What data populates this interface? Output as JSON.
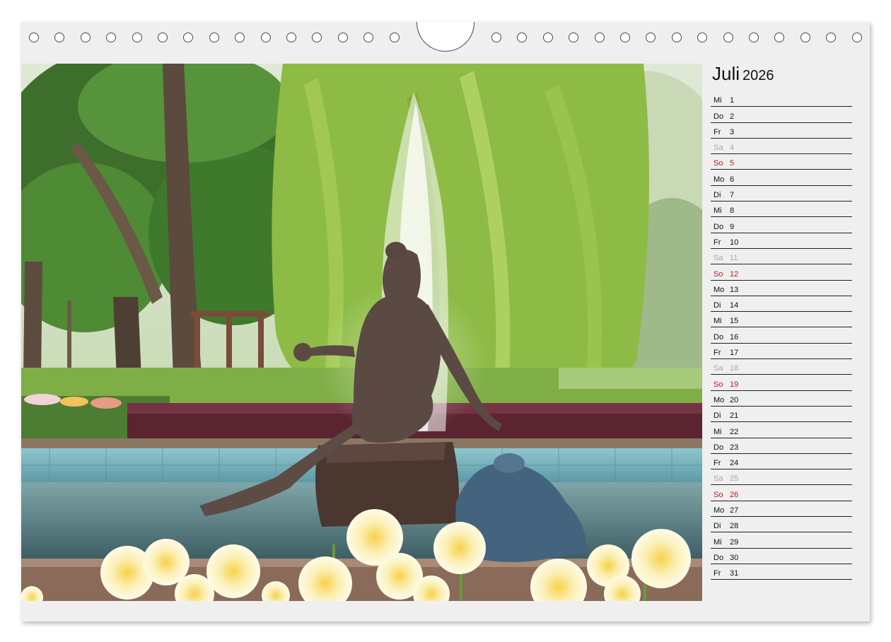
{
  "calendar": {
    "month": "Juli",
    "year": "2026",
    "colors": {
      "weekday": "#111111",
      "saturday": "#a8a8a8",
      "sunday": "#c8161d",
      "page": "#efefef"
    },
    "days": [
      {
        "day": "Mi",
        "date": "1",
        "kind": "weekday"
      },
      {
        "day": "Do",
        "date": "2",
        "kind": "weekday"
      },
      {
        "day": "Fr",
        "date": "3",
        "kind": "weekday"
      },
      {
        "day": "Sa",
        "date": "4",
        "kind": "saturday"
      },
      {
        "day": "So",
        "date": "5",
        "kind": "sunday"
      },
      {
        "day": "Mo",
        "date": "6",
        "kind": "weekday"
      },
      {
        "day": "Di",
        "date": "7",
        "kind": "weekday"
      },
      {
        "day": "Mi",
        "date": "8",
        "kind": "weekday"
      },
      {
        "day": "Do",
        "date": "9",
        "kind": "weekday"
      },
      {
        "day": "Fr",
        "date": "10",
        "kind": "weekday"
      },
      {
        "day": "Sa",
        "date": "11",
        "kind": "saturday"
      },
      {
        "day": "So",
        "date": "12",
        "kind": "sunday"
      },
      {
        "day": "Mo",
        "date": "13",
        "kind": "weekday"
      },
      {
        "day": "Di",
        "date": "14",
        "kind": "weekday"
      },
      {
        "day": "Mi",
        "date": "15",
        "kind": "weekday"
      },
      {
        "day": "Do",
        "date": "16",
        "kind": "weekday"
      },
      {
        "day": "Fr",
        "date": "17",
        "kind": "weekday"
      },
      {
        "day": "Sa",
        "date": "18",
        "kind": "saturday"
      },
      {
        "day": "So",
        "date": "19",
        "kind": "sunday"
      },
      {
        "day": "Mo",
        "date": "20",
        "kind": "weekday"
      },
      {
        "day": "Di",
        "date": "21",
        "kind": "weekday"
      },
      {
        "day": "Mi",
        "date": "22",
        "kind": "weekday"
      },
      {
        "day": "Do",
        "date": "23",
        "kind": "weekday"
      },
      {
        "day": "Fr",
        "date": "24",
        "kind": "weekday"
      },
      {
        "day": "Sa",
        "date": "25",
        "kind": "saturday"
      },
      {
        "day": "So",
        "date": "26",
        "kind": "sunday"
      },
      {
        "day": "Mo",
        "date": "27",
        "kind": "weekday"
      },
      {
        "day": "Di",
        "date": "28",
        "kind": "weekday"
      },
      {
        "day": "Mi",
        "date": "29",
        "kind": "weekday"
      },
      {
        "day": "Do",
        "date": "30",
        "kind": "weekday"
      },
      {
        "day": "Fr",
        "date": "31",
        "kind": "weekday"
      }
    ]
  },
  "binding": {
    "hole_icon": "ring-hole-icon",
    "hanger_icon": "hanger-notch-icon"
  }
}
